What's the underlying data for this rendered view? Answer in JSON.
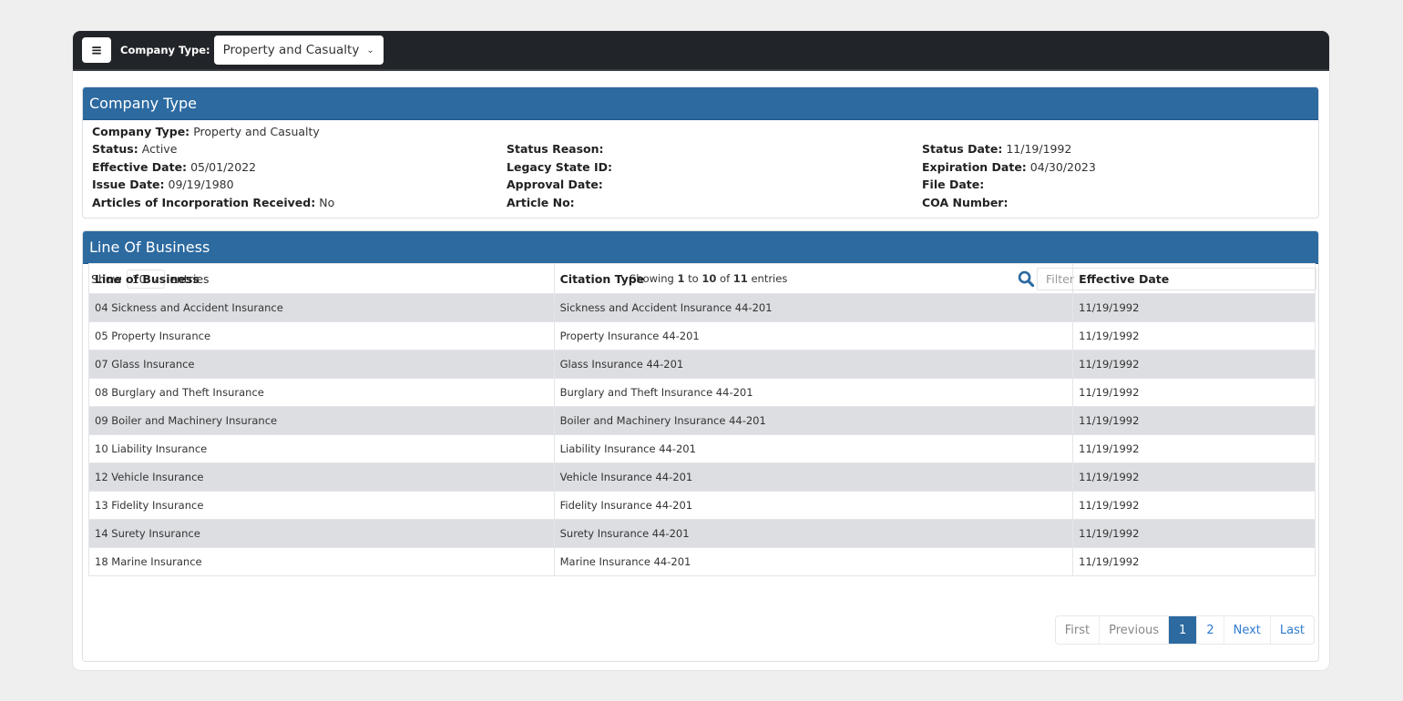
{
  "navbar": {
    "menu_icon": "hamburger-menu-icon",
    "company_type_label": "Company Type:",
    "company_type_selected": "Property and Casualty"
  },
  "company_card": {
    "title": "Company Type",
    "fields": {
      "company_type": {
        "label": "Company Type:",
        "value": "Property and Casualty"
      },
      "status": {
        "label": "Status:",
        "value": "Active"
      },
      "effective_date": {
        "label": "Effective Date:",
        "value": "05/01/2022"
      },
      "issue_date": {
        "label": "Issue Date:",
        "value": "09/19/1980"
      },
      "articles_received": {
        "label": "Articles of Incorporation Received:",
        "value": "No"
      },
      "status_reason": {
        "label": "Status Reason:",
        "value": ""
      },
      "legacy_state_id": {
        "label": "Legacy State ID:",
        "value": ""
      },
      "approval_date": {
        "label": "Approval Date:",
        "value": ""
      },
      "article_no": {
        "label": "Article No:",
        "value": ""
      },
      "status_date": {
        "label": "Status Date:",
        "value": "11/19/1992"
      },
      "expiration_date": {
        "label": "Expiration Date:",
        "value": "04/30/2023"
      },
      "file_date": {
        "label": "File Date:",
        "value": ""
      },
      "coa_number": {
        "label": "COA Number:",
        "value": ""
      }
    }
  },
  "lob_card": {
    "title": "Line Of Business",
    "show_label": "Show",
    "entries_label": "entries",
    "page_length": "10",
    "info": {
      "prefix": "Showing",
      "from": "1",
      "to_word": "to",
      "to": "10",
      "of_word": "of",
      "total": "11",
      "suffix": "entries"
    },
    "filter_placeholder": "Filter",
    "columns": [
      "Line of Business",
      "Citation Type",
      "Effective Date"
    ],
    "rows": [
      [
        "04 Sickness and Accident Insurance",
        "Sickness and Accident Insurance 44-201",
        "11/19/1992"
      ],
      [
        "05 Property Insurance",
        "Property Insurance 44-201",
        "11/19/1992"
      ],
      [
        "07 Glass Insurance",
        "Glass Insurance 44-201",
        "11/19/1992"
      ],
      [
        "08 Burglary and Theft Insurance",
        "Burglary and Theft Insurance 44-201",
        "11/19/1992"
      ],
      [
        "09 Boiler and Machinery Insurance",
        "Boiler and Machinery Insurance 44-201",
        "11/19/1992"
      ],
      [
        "10 Liability Insurance",
        "Liability Insurance 44-201",
        "11/19/1992"
      ],
      [
        "12 Vehicle Insurance",
        "Vehicle Insurance 44-201",
        "11/19/1992"
      ],
      [
        "13 Fidelity Insurance",
        "Fidelity Insurance 44-201",
        "11/19/1992"
      ],
      [
        "14 Surety Insurance",
        "Surety Insurance 44-201",
        "11/19/1992"
      ],
      [
        "18 Marine Insurance",
        "Marine Insurance 44-201",
        "11/19/1992"
      ]
    ],
    "pagination": {
      "first": "First",
      "previous": "Previous",
      "pages": [
        "1",
        "2"
      ],
      "current_page": "1",
      "next": "Next",
      "last": "Last"
    }
  },
  "colors": {
    "navbar_bg": "#212428",
    "header_blue": "#2c6aa0",
    "link_blue": "#2f7ad0",
    "stripe_gray": "#dcdee2"
  }
}
